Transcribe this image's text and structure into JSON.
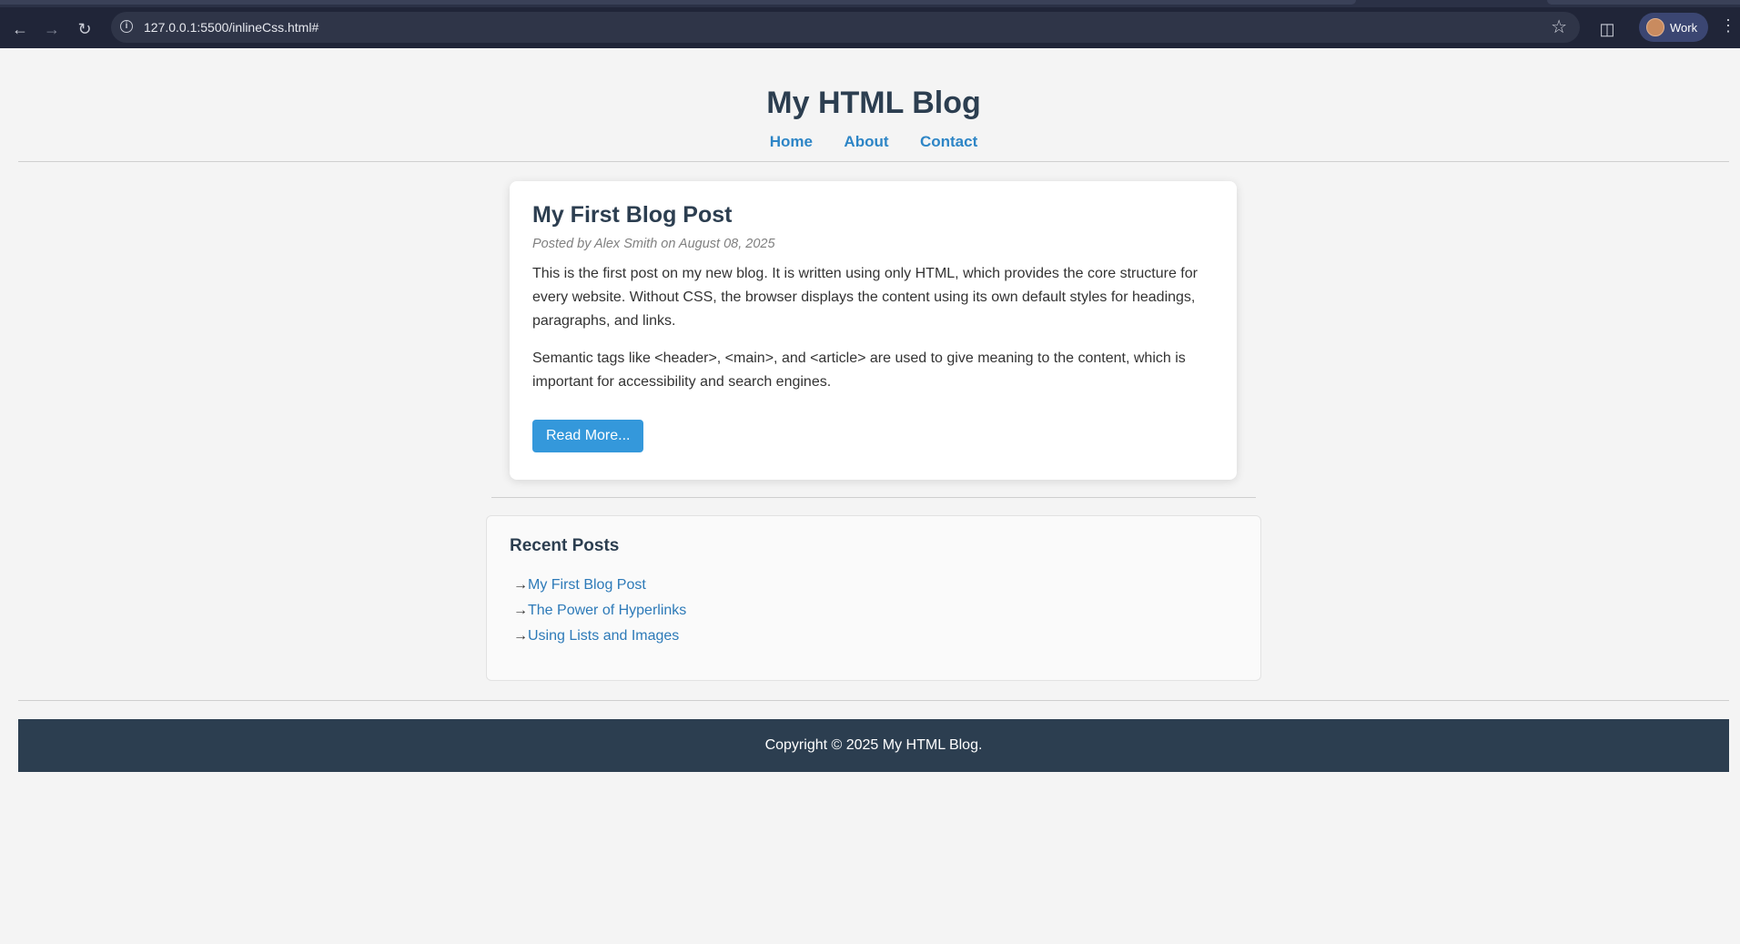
{
  "browser": {
    "url": "127.0.0.1:5500/inlineCss.html#",
    "profile_label": "Work"
  },
  "site": {
    "title": "My HTML Blog",
    "nav": [
      "Home",
      "About",
      "Contact"
    ]
  },
  "post": {
    "title": "My First Blog Post",
    "meta": "Posted by Alex Smith on August 08, 2025",
    "paragraphs": [
      "This is the first post on my new blog. It is written using only HTML, which provides the core structure for every website. Without CSS, the browser displays the content using its own default styles for headings, paragraphs, and links.",
      "Semantic tags like <header>, <main>, and <article> are used to give meaning to the content, which is important for accessibility and search engines."
    ],
    "read_more_label": "Read More..."
  },
  "recent": {
    "title": "Recent Posts",
    "arrow": "→",
    "items": [
      "My First Blog Post",
      "The Power of Hyperlinks",
      "Using Lists and Images"
    ]
  },
  "footer": {
    "text": "Copyright © 2025 My HTML Blog."
  },
  "colors": {
    "header_text": "#2c3e50",
    "link": "#2d85c6",
    "button": "#3498db",
    "footer_bg": "#2c3e50"
  }
}
